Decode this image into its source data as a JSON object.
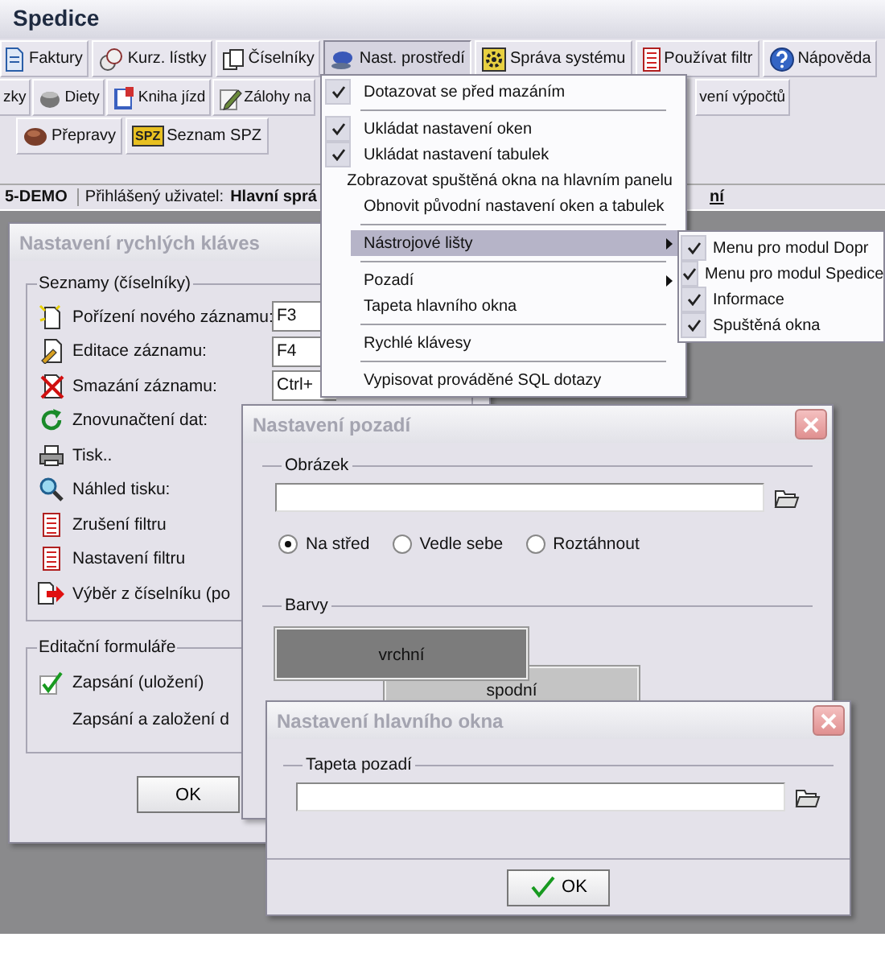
{
  "app": {
    "title": "Spedice"
  },
  "toolbars": [
    {
      "buttons": [
        {
          "label": "Faktury",
          "pressed": false
        },
        {
          "label": "Kurz. lístky",
          "pressed": false
        },
        {
          "label": "Číselníky",
          "pressed": false
        },
        {
          "label": "Nast. prostředí",
          "pressed": true
        },
        {
          "label": "Správa systému",
          "pressed": false
        },
        {
          "label": "Používat filtr",
          "pressed": false
        },
        {
          "label": "Nápověda",
          "pressed": false
        }
      ]
    },
    {
      "buttons": [
        {
          "label": "zky",
          "pressed": false
        },
        {
          "label": "Diety",
          "pressed": false
        },
        {
          "label": "Kniha jízd",
          "pressed": false
        },
        {
          "label": "Zálohy na",
          "pressed": false
        },
        {
          "label": "vení výpočtů",
          "pressed": false
        }
      ]
    },
    {
      "buttons": [
        {
          "label": "Přepravy",
          "pressed": false
        },
        {
          "label": "Seznam SPZ",
          "badge": "SPZ",
          "pressed": false
        }
      ]
    }
  ],
  "status_bar": {
    "version": "5-DEMO",
    "user_label": "Přihlášený uživatel:",
    "user_name": "Hlavní sprá",
    "panel_3": "ní"
  },
  "menu": {
    "items": [
      {
        "kind": "item",
        "label": "Dotazovat se před mazáním",
        "checked": true,
        "selected": false
      },
      {
        "kind": "separator"
      },
      {
        "kind": "item",
        "label": "Ukládat nastavení oken",
        "checked": true,
        "selected": false
      },
      {
        "kind": "item",
        "label": "Ukládat nastavení tabulek",
        "checked": true,
        "selected": false
      },
      {
        "kind": "item",
        "label": "Zobrazovat spuštěná okna na hlavním panelu",
        "checked": false,
        "selected": false
      },
      {
        "kind": "item",
        "label": "Obnovit původní nastavení oken a tabulek",
        "checked": false,
        "selected": false
      },
      {
        "kind": "separator"
      },
      {
        "kind": "submenu",
        "label": "Nástrojové lišty",
        "checked": false,
        "selected": true
      },
      {
        "kind": "separator"
      },
      {
        "kind": "submenu",
        "label": "Pozadí",
        "checked": false,
        "selected": false
      },
      {
        "kind": "item",
        "label": "Tapeta hlavního okna",
        "checked": false,
        "selected": false
      },
      {
        "kind": "separator"
      },
      {
        "kind": "item",
        "label": "Rychlé klávesy",
        "checked": false,
        "selected": false
      },
      {
        "kind": "separator"
      },
      {
        "kind": "item",
        "label": "Vypisovat prováděné SQL dotazy",
        "checked": false,
        "selected": false
      }
    ]
  },
  "submenu": {
    "items": [
      {
        "label": "Menu pro modul Dopr",
        "checked": true
      },
      {
        "label": "Menu pro modul Spedice",
        "checked": true
      },
      {
        "label": "Informace",
        "checked": true
      },
      {
        "label": "Spuštěná okna",
        "checked": true
      }
    ]
  },
  "hotkeys_dialog": {
    "title": "Nastavení rychlých kláves",
    "groups": [
      {
        "title": "Seznamy (číselníky)",
        "rows": [
          {
            "label": "Pořízení nového záznamu:",
            "key": "F3"
          },
          {
            "label": "Editace záznamu:",
            "key": "F4"
          },
          {
            "label": "Smazání záznamu:",
            "key": "Ctrl+"
          },
          {
            "label": "Znovunačtení dat:"
          },
          {
            "label": "Tisk.."
          },
          {
            "label": "Náhled tisku:"
          },
          {
            "label": "Zrušení filtru"
          },
          {
            "label": "Nastavení filtru"
          },
          {
            "label": "Výběr z číselníku (po"
          }
        ]
      },
      {
        "title": "Editační formuláře",
        "rows": [
          {
            "label": "Zapsání (uložení)"
          },
          {
            "label": "Zapsání a založení d"
          }
        ]
      }
    ],
    "ok_button": "OK"
  },
  "background_dialog": {
    "title": "Nastavení pozadí",
    "image_group": "Obrázek",
    "placement": [
      {
        "label": "Na střed",
        "selected": true
      },
      {
        "label": "Vedle sebe",
        "selected": false
      },
      {
        "label": "Roztáhnout",
        "selected": false
      }
    ],
    "colors_group": "Barvy",
    "swatches": [
      {
        "label": "vrchní",
        "color": "#7c7c7c"
      },
      {
        "label": "spodní",
        "color": "#c4c4c4"
      }
    ]
  },
  "main_window_dialog": {
    "title": "Nastavení hlavního okna",
    "group": "Tapeta pozadí",
    "ok_button": "OK"
  }
}
